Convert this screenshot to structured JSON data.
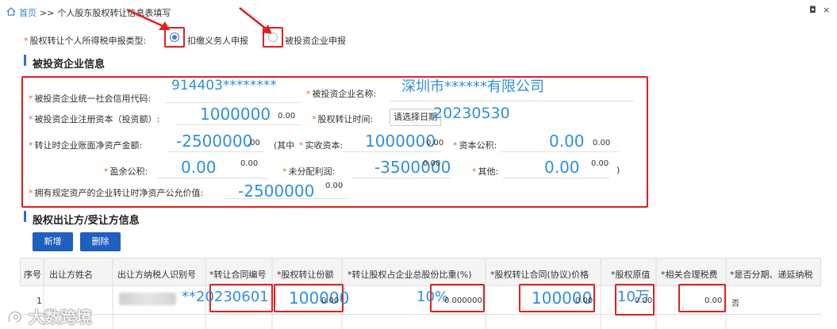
{
  "breadcrumb": {
    "home_label": "首页",
    "sep": ">>",
    "current": "个人股东股权转让信息表填写"
  },
  "window": {
    "restore_glyph": "◘",
    "close_glyph": "×"
  },
  "declaration": {
    "label": "股权转让个人所得税申报类型:",
    "option1": "扣缴义务人申报",
    "option2": "被投资企业申报",
    "selected": "扣缴义务人申报"
  },
  "section1": {
    "title": "被投资企业信息",
    "credit_code_label": "被投资企业统一社会信用代码:",
    "credit_code_value": "914403********",
    "company_name_label": "被投资企业名称:",
    "company_name_value": "深圳市******有限公司",
    "reg_capital_label": "被投资企业注册资本（投资额）:",
    "reg_capital_value": "1000000",
    "reg_capital_small": "0.00",
    "transfer_time_label": "股权转让时间:",
    "date_placeholder": "请选择日期",
    "transfer_time_value": "20230530",
    "net_assets_label": "转让时企业账面净资产金额:",
    "net_assets_value": "-2500000",
    "net_assets_small": ".00",
    "paren_open": "(其中",
    "paid_capital_label": "实收资本:",
    "paid_capital_value": "1000000",
    "paid_capital_small": "0.00",
    "capital_reserve_label": "资本公积:",
    "capital_reserve_value": "0.00",
    "capital_reserve_small": "0.00",
    "surplus_reserve_label": "盈余公积:",
    "surplus_reserve_value": "0.00",
    "surplus_reserve_small": "0.00",
    "undistributed_label": "未分配利润:",
    "undistributed_value": "-3500000",
    "undistributed_small": "0.00",
    "other_label": "其他:",
    "other_value": "0.00",
    "other_small": "0.00",
    "paren_close": ")",
    "fair_value_label": "拥有规定资产的企业转让时净资产公允价值:",
    "fair_value_value": "-2500000",
    "fair_value_small": "0.00"
  },
  "section2": {
    "title": "股权出让方/受让方信息",
    "add_button": "新增",
    "delete_button": "删除",
    "columns": [
      "序号",
      "出让方姓名",
      "出让方纳税人识别号",
      "*转让合同编号",
      "*股权转让份额",
      "*转让股权占企业总股份比重(%)",
      "*股权转让合同(协议)价格",
      "*股权原值",
      "*相关合理税费",
      "*是否分期、递延纳税"
    ],
    "row": {
      "index": "1",
      "contract_no": "**20230601",
      "share_amount": "100000",
      "share_amount_small": "0.00",
      "ratio": "10%",
      "ratio_small": "0.000000",
      "price": "100000",
      "price_small": "0.00",
      "original_value": "10万",
      "original_value_small": "0.00",
      "tax_fee": "0.00",
      "installment": "否"
    }
  },
  "watermark": "大数跨境",
  "colors": {
    "accent": "#1f5fbf",
    "annotation_red": "#e02020",
    "handwritten_blue": "#2f8fe0"
  }
}
